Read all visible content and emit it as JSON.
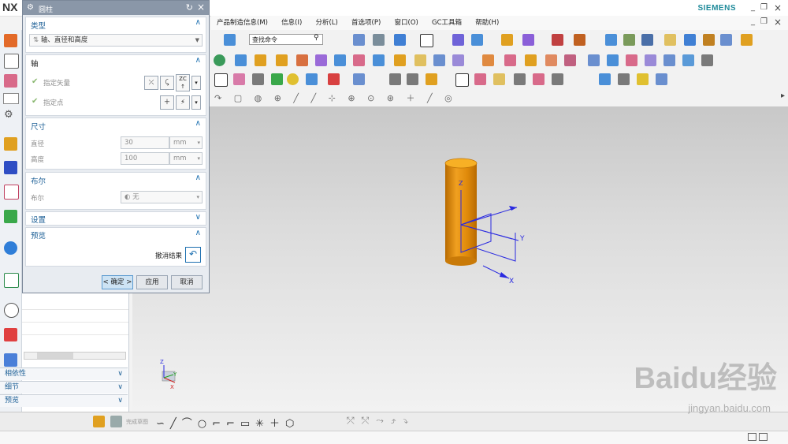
{
  "app": {
    "logo": "NX",
    "brand": "SIEMENS"
  },
  "menu": [
    "产品制造信息(M)",
    "信息(I)",
    "分析(L)",
    "首选项(P)",
    "窗口(O)",
    "GC工具箱",
    "帮助(H)"
  ],
  "search": {
    "placeholder": "查找命令"
  },
  "dialog": {
    "title": "圆柱",
    "type": {
      "header": "类型",
      "value": "轴、直径和高度"
    },
    "axis": {
      "header": "轴",
      "vector_label": "指定矢量",
      "point_label": "指定点",
      "vector_badge": "ZC"
    },
    "dimensions": {
      "header": "尺寸",
      "diameter": {
        "label": "直径",
        "value": "30",
        "unit": "mm"
      },
      "height": {
        "label": "高度",
        "value": "100",
        "unit": "mm"
      }
    },
    "boolean": {
      "header": "布尔",
      "label": "布尔",
      "value": "无"
    },
    "settings": {
      "header": "设置"
    },
    "preview": {
      "header": "预览",
      "undo_label": "撤消结果"
    },
    "buttons": {
      "ok": "< 确定 >",
      "apply": "应用",
      "cancel": "取消"
    }
  },
  "navigator": {
    "sections": [
      "相依性",
      "细节",
      "预览"
    ]
  },
  "viewport": {
    "axes": {
      "x": "X",
      "y": "Y",
      "z": "Z"
    }
  },
  "bottombar": {
    "sketch_label": "完成草图"
  },
  "watermark": {
    "logo": "Baidu经验",
    "url": "jingyan.baidu.com"
  },
  "colors": {
    "accent": "#1c6fb0",
    "cylinder": "#e08a0a",
    "axis": "#2a2ae0",
    "dialog_title": "#8a97a8"
  }
}
